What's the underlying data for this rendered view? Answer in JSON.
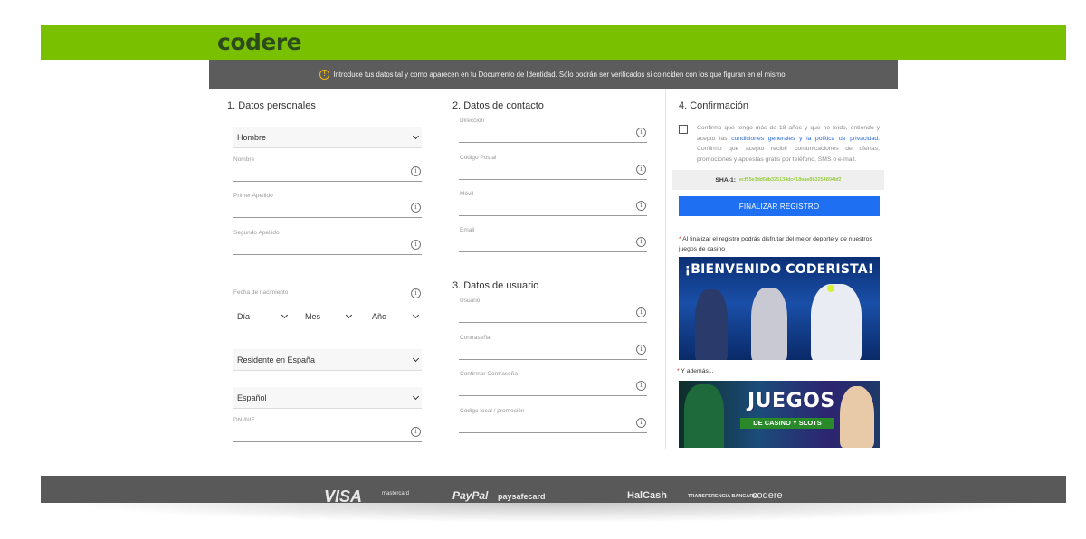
{
  "header": {
    "logo_text": "codere",
    "bg_color": "#79c000"
  },
  "notice": {
    "text": "Introduce tus datos tal y como aparecen en tu Documento de Identidad. Sólo podrán ser verificados si coinciden con los que figuran en el mismo."
  },
  "section1": {
    "title": "1. Datos personales",
    "gender": "Hombre",
    "nombre_label": "Nombre",
    "apellido1_label": "Primer Apellido",
    "apellido2_label": "Segundo Apellido",
    "fecha_label": "Fecha de nacimiento",
    "dia": "Día",
    "mes": "Mes",
    "anio": "Año",
    "residence": "Residente en España",
    "nationality": "Español",
    "dni_label": "DNI/NIE"
  },
  "section2": {
    "title": "2. Datos de contacto",
    "direccion_label": "Dirección",
    "cp_label": "Código Postal",
    "movil_label": "Móvil",
    "email_label": "Email"
  },
  "section3": {
    "title": "3. Datos de usuario",
    "usuario_label": "Usuario",
    "password_label": "Contraseña",
    "confirm_label": "Confirmar Contraseña",
    "promo_label": "Código local / promoción"
  },
  "section4": {
    "title": "4. Confirmación",
    "consent_part1": "Confirmo que tengo más de 18 años y que he leído, entiendo y acepto las",
    "consent_link": "condiciones generales y la política de privacidad.",
    "consent_part2": "Confirmo que acepto recibir comunicaciones de ofertas, promociones y apuestas gratis por teléfono, SMS o e-mail.",
    "sha_label": "SHA-1:",
    "sha_value": "ecf55e3dd6db325134dc418eae8b3254894bf2",
    "finalize_label": "FINALIZAR REGISTRO",
    "note1_star": "*",
    "note1_text": "Al finalizar el registro podrás disfrutar del mejor deporte y de nuestros juegos de casino",
    "banner1_title": "¡BIENVENIDO CODERISTA!",
    "note2_star": "*",
    "note2_text": "Y además...",
    "banner2_title": "JUEGOS",
    "banner2_sub": "DE CASINO Y SLOTS"
  },
  "footer": {
    "payments": [
      "VISA",
      "mastercard",
      "PayPal",
      "paysafecard",
      "HalCash",
      "TRANSFERENCIA BANCARIA",
      "codere"
    ]
  },
  "icons": {
    "info": "info-icon",
    "chevron": "chevron-down-icon",
    "warning": "warning-icon"
  }
}
